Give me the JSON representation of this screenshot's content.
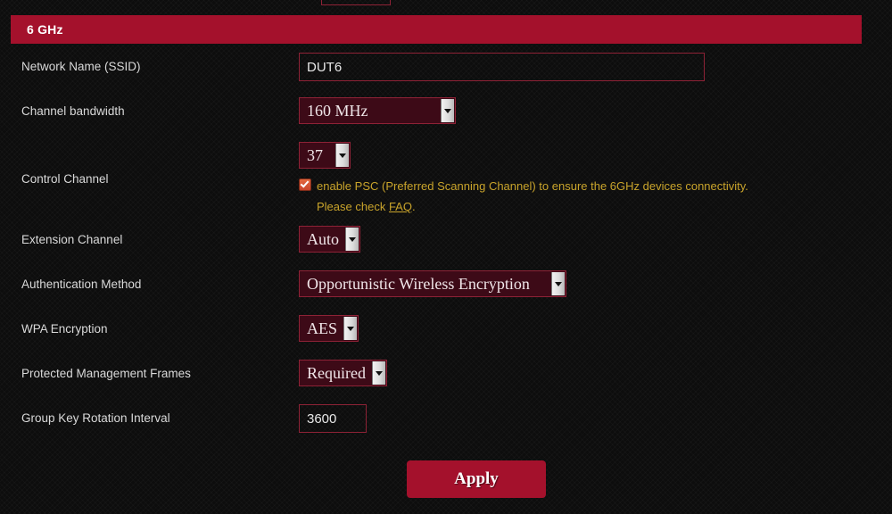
{
  "band": {
    "header_title": "6 GHz"
  },
  "clipped_field_above": {
    "name": "clipped-input-above"
  },
  "rows": [
    {
      "label": "Network Name (SSID)",
      "control": "text",
      "value": "DUT6",
      "placeholder": ""
    },
    {
      "label": "Channel bandwidth",
      "control": "select",
      "value": "160 MHz"
    },
    {
      "label": "Control Channel",
      "control": "select",
      "value": "37"
    },
    {
      "label": "Extension Channel",
      "control": "select",
      "value": "Auto"
    },
    {
      "label": "Authentication Method",
      "control": "select",
      "value": "Opportunistic Wireless Encryption"
    },
    {
      "label": "WPA Encryption",
      "control": "select",
      "value": "AES"
    },
    {
      "label": "Protected Management Frames",
      "control": "select",
      "value": "Required"
    },
    {
      "label": "Group Key Rotation Interval",
      "control": "text",
      "value": "3600",
      "placeholder": ""
    }
  ],
  "psc": {
    "checked": true,
    "text_line1": "enable PSC (Preferred Scanning Channel) to ensure the 6GHz devices connectivity.",
    "text_line2_prefix": "Please check ",
    "link_label": "FAQ",
    "text_line2_suffix": "."
  },
  "actions": {
    "apply_label": "Apply"
  },
  "colors": {
    "accent_crimson": "#a4112c",
    "border_crimson": "#8e2236",
    "select_bg": "#3d0a17",
    "hint_gold": "#c9a42b",
    "checkbox_orange": "#c9442a",
    "page_bg": "#0d0d0d",
    "label_text": "#d9d9d9"
  }
}
